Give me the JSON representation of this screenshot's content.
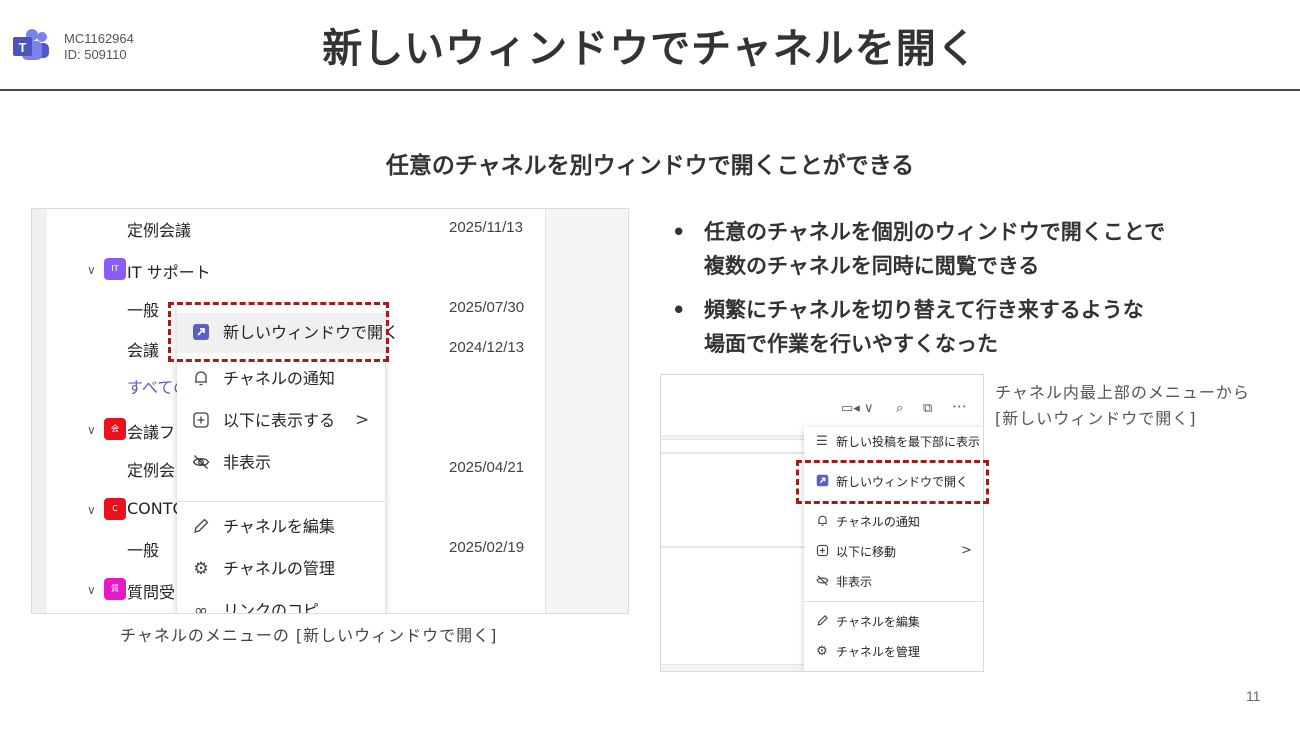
{
  "header": {
    "mc_id": "MC1162964",
    "id_line": "ID: 509110",
    "title": "新しいウィンドウでチャネルを開く"
  },
  "subtitle": "任意のチャネルを別ウィンドウで開くことができる",
  "left_screenshot": {
    "rows": [
      {
        "label": "定例会議",
        "date": "2025/11/13"
      },
      {
        "label": "IT サポート",
        "tile": "IT",
        "tile_color": "#8b5cf6"
      },
      {
        "label": "一般",
        "date": "2025/07/30"
      },
      {
        "label": "会議",
        "date": "2024/12/13"
      },
      {
        "label": "すべての"
      },
      {
        "label": "会議フ",
        "tile_color": "#e8111e"
      },
      {
        "label": "定例会",
        "date": "2025/04/21"
      },
      {
        "label": "CONTO",
        "tile": "C",
        "tile_color": "#e8111e"
      },
      {
        "label": "一般",
        "date": "2025/02/19"
      },
      {
        "label": "質問受",
        "tile_color": "#e619c6"
      }
    ],
    "menu": {
      "items": [
        {
          "label": "新しいウィンドウで開く",
          "icon": "open-in-window-icon"
        },
        {
          "label": "チャネルの通知",
          "icon": "bell-icon"
        },
        {
          "label": "以下に表示する",
          "icon": "add-square-icon",
          "chevron": ">"
        },
        {
          "label": "非表示",
          "icon": "eye-off-icon"
        },
        {
          "label": "チャネルを編集",
          "icon": "pencil-icon"
        },
        {
          "label": "チャネルの管理",
          "icon": "gear-icon"
        },
        {
          "label": "リンクのコピ",
          "icon": "link-icon"
        }
      ]
    },
    "caption": "チャネルのメニューの [新しいウィンドウで開く]"
  },
  "bullets": [
    {
      "line1": "任意のチャネルを個別のウィンドウで開くことで",
      "line2": "複数のチャネルを同時に閲覧できる"
    },
    {
      "line1": "頻繁にチャネルを切り替えて行き来するような",
      "line2": "場面で作業を行いやすくなった"
    }
  ],
  "right_screenshot": {
    "menu": {
      "items": [
        {
          "label": "新しい投稿を最下部に表示",
          "icon": "lines-icon"
        },
        {
          "label": "新しいウィンドウで開く",
          "icon": "open-in-window-icon"
        },
        {
          "label": "チャネルの通知",
          "icon": "bell-icon"
        },
        {
          "label": "以下に移動",
          "icon": "add-square-icon",
          "chevron": ">"
        },
        {
          "label": "非表示",
          "icon": "eye-off-icon"
        },
        {
          "label": "チャネルを編集",
          "icon": "pencil-icon"
        },
        {
          "label": "チャネルを管理",
          "icon": "gear-icon"
        }
      ]
    },
    "caption_line1": "チャネル内最上部のメニューから",
    "caption_line2": "[新しいウィンドウで開く]"
  },
  "page_number": "11",
  "colors": {
    "accent": "#5b5fc7",
    "highlight_border": "#a31c1c",
    "title_rule": "#3b4a5a"
  }
}
